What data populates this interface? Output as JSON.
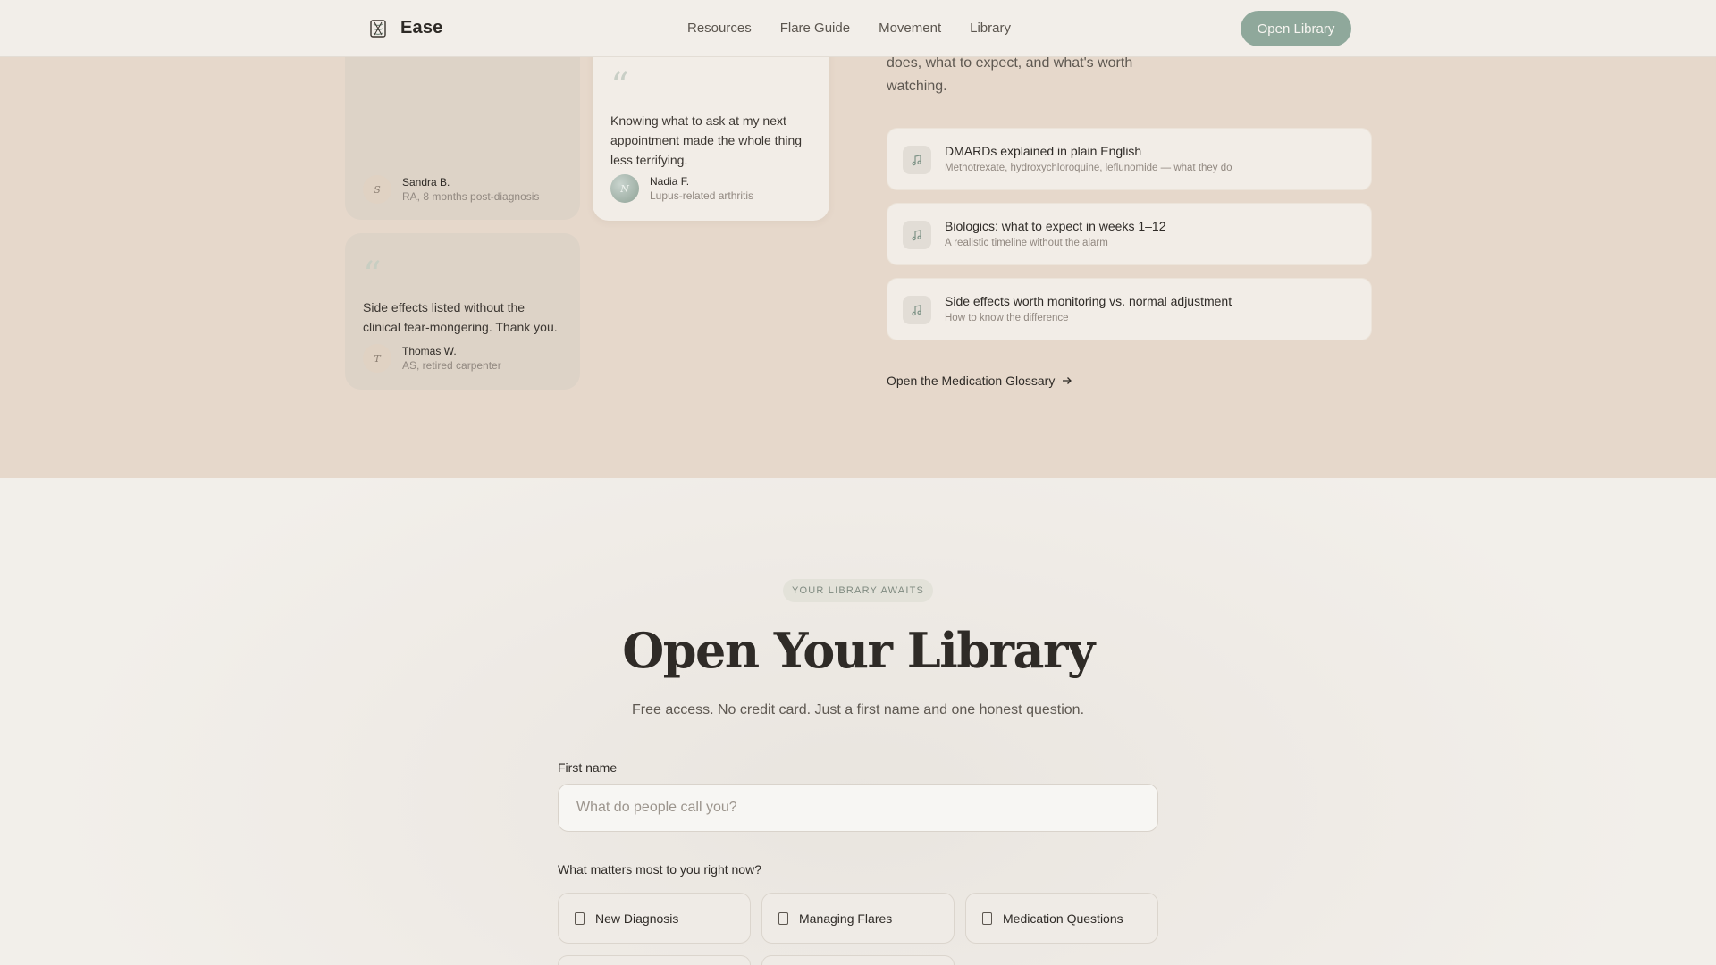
{
  "nav": {
    "brand": "Ease",
    "links": [
      "Resources",
      "Flare Guide",
      "Movement",
      "Library"
    ],
    "cta": "Open Library"
  },
  "testimonials": [
    {
      "quote": "",
      "name": "Sandra B.",
      "meta": "RA, 8 months post-diagnosis",
      "initial": "S"
    },
    {
      "quote": "Knowing what to ask at my next appointment made the whole thing less terrifying.",
      "name": "Nadia F.",
      "meta": "Lupus-related arthritis",
      "initial": "N"
    },
    {
      "quote": "Side effects listed without the clinical fear-mongering. Thank you.",
      "name": "Thomas W.",
      "meta": "AS, retired carpenter",
      "initial": "T"
    }
  ],
  "medication": {
    "intro": "does, what to expect, and what's worth watching.",
    "items": [
      {
        "title": "DMARDs explained in plain English",
        "subtitle": "Methotrexate, hydroxychloroquine, leflunomide — what they do"
      },
      {
        "title": "Biologics: what to expect in weeks 1–12",
        "subtitle": "A realistic timeline without the alarm"
      },
      {
        "title": "Side effects worth monitoring vs. normal adjustment",
        "subtitle": "How to know the difference"
      }
    ],
    "glossary_link": "Open the Medication Glossary"
  },
  "signup": {
    "badge": "YOUR LIBRARY AWAITS",
    "headline": "Open Your Library",
    "subline": "Free access. No credit card. Just a first name and one honest question.",
    "first_name_label": "First name",
    "first_name_placeholder": "What do people call you?",
    "question_label": "What matters most to you right now?",
    "options": [
      "New Diagnosis",
      "Managing Flares",
      "Medication Questions"
    ]
  },
  "colors": {
    "accent": "#8fa89b",
    "upper_bg": "#e6d8cb",
    "lower_bg": "#f1ede8"
  }
}
